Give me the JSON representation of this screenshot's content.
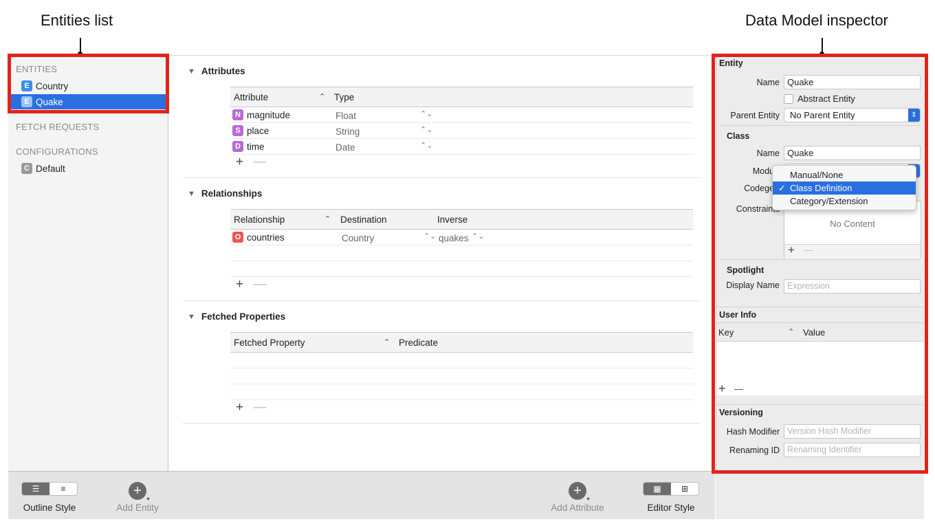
{
  "callouts": {
    "entities_list": "Entities list",
    "inspector": "Data Model inspector"
  },
  "sidebar": {
    "entities_header": "ENTITIES",
    "entities": [
      {
        "badge": "E",
        "label": "Country"
      },
      {
        "badge": "E",
        "label": "Quake"
      }
    ],
    "fetch_requests_header": "FETCH REQUESTS",
    "configurations_header": "CONFIGURATIONS",
    "configurations": [
      {
        "badge": "C",
        "label": "Default"
      }
    ]
  },
  "attributes": {
    "title": "Attributes",
    "columns": [
      "Attribute",
      "Type"
    ],
    "rows": [
      {
        "badge": "N",
        "name": "magnitude",
        "type": "Float"
      },
      {
        "badge": "S",
        "name": "place",
        "type": "String"
      },
      {
        "badge": "D",
        "name": "time",
        "type": "Date"
      }
    ]
  },
  "relationships": {
    "title": "Relationships",
    "columns": [
      "Relationship",
      "Destination",
      "Inverse"
    ],
    "rows": [
      {
        "badge": "O",
        "name": "countries",
        "destination": "Country",
        "inverse": "quakes"
      }
    ]
  },
  "fetched_properties": {
    "title": "Fetched Properties",
    "columns": [
      "Fetched Property",
      "Predicate"
    ]
  },
  "inspector": {
    "entity_header": "Entity",
    "name_label": "Name",
    "name_value": "Quake",
    "abstract_label": "Abstract Entity",
    "parent_label": "Parent Entity",
    "parent_value": "No Parent Entity",
    "class_header": "Class",
    "class_name_label": "Name",
    "class_name_value": "Quake",
    "module_label": "Modu",
    "codegen_label": "Codege",
    "codegen_options": [
      "Manual/None",
      "Class Definition",
      "Category/Extension"
    ],
    "codegen_selected": "Class Definition",
    "constraints_label": "Constraints",
    "no_content": "No Content",
    "spotlight_header": "Spotlight",
    "display_name_label": "Display Name",
    "display_name_placeholder": "Expression",
    "user_info_header": "User Info",
    "user_info_columns": [
      "Key",
      "Value"
    ],
    "versioning_header": "Versioning",
    "hash_modifier_label": "Hash Modifier",
    "hash_modifier_placeholder": "Version Hash Modifier",
    "renaming_id_label": "Renaming ID",
    "renaming_id_placeholder": "Renaming Identifier"
  },
  "toolbar": {
    "outline_style": "Outline Style",
    "add_entity": "Add Entity",
    "add_attribute": "Add Attribute",
    "editor_style": "Editor Style"
  },
  "colors": {
    "highlight_red": "#e2231a",
    "selection_blue": "#2a6fe0"
  }
}
